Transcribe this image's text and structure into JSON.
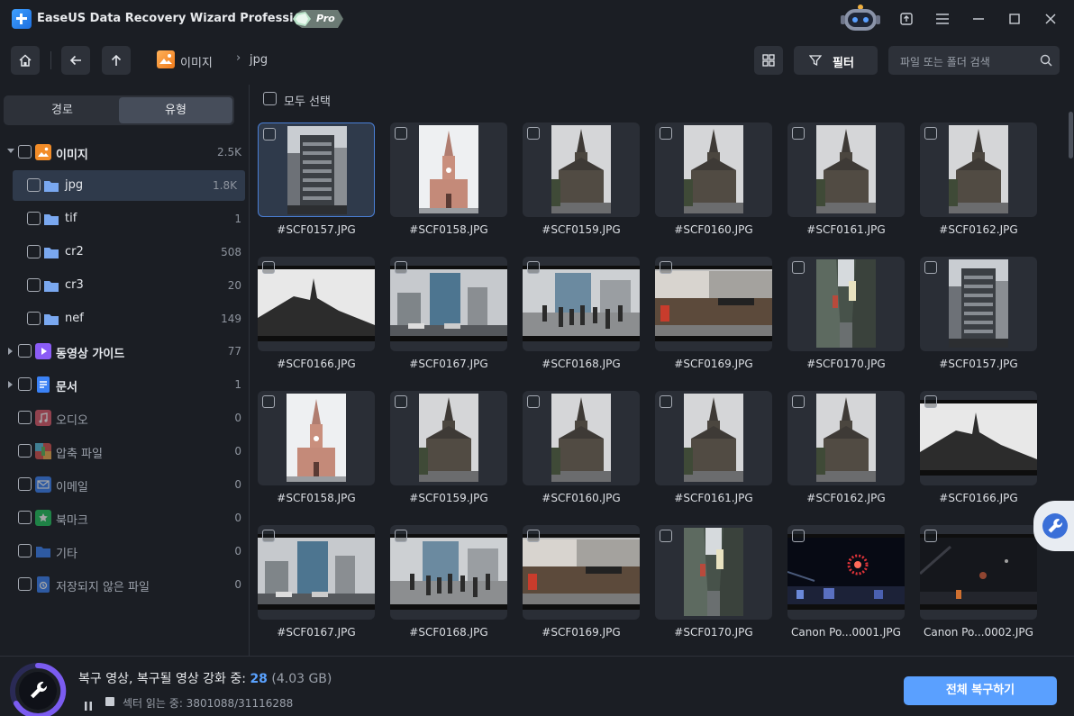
{
  "app": {
    "title": "EaseUS Data Recovery Wizard Professional",
    "badge": "Pro"
  },
  "nav": {
    "breadcrumb": [
      {
        "label": "이미지"
      },
      {
        "label": "jpg"
      }
    ],
    "filter_label": "필터",
    "search_placeholder": "파일 또는 폴더 검색"
  },
  "sidebar": {
    "tabs": [
      {
        "label": "경로",
        "active": false
      },
      {
        "label": "유형",
        "active": true
      }
    ],
    "items": [
      {
        "label": "이미지",
        "count": "2.5K",
        "icon": "image-folder-icon",
        "color": "#f28c28"
      },
      {
        "label": "jpg",
        "count": "1.8K",
        "icon": "folder-icon",
        "color": "#7aa8f0"
      },
      {
        "label": "tif",
        "count": "1",
        "icon": "folder-icon",
        "color": "#7aa8f0"
      },
      {
        "label": "cr2",
        "count": "508",
        "icon": "folder-icon",
        "color": "#7aa8f0"
      },
      {
        "label": "cr3",
        "count": "20",
        "icon": "folder-icon",
        "color": "#7aa8f0"
      },
      {
        "label": "nef",
        "count": "149",
        "icon": "folder-icon",
        "color": "#7aa8f0"
      },
      {
        "label": "동영상 가이드",
        "count": "77",
        "icon": "video-icon",
        "color": "#8b5cf6"
      },
      {
        "label": "문서",
        "count": "1",
        "icon": "document-icon",
        "color": "#3b82f6"
      },
      {
        "label": "오디오",
        "count": "0",
        "icon": "audio-icon",
        "color": "#e05a6a"
      },
      {
        "label": "압축 파일",
        "count": "0",
        "icon": "archive-icon",
        "color": "#4a90e2"
      },
      {
        "label": "이메일",
        "count": "0",
        "icon": "email-icon",
        "color": "#3b82f6"
      },
      {
        "label": "북마크",
        "count": "0",
        "icon": "bookmark-icon",
        "color": "#22c55e"
      },
      {
        "label": "기타",
        "count": "0",
        "icon": "other-folder-icon",
        "color": "#3b82f6"
      },
      {
        "label": "저장되지 않은 파일",
        "count": "0",
        "icon": "unsaved-file-icon",
        "color": "#3b82f6"
      }
    ]
  },
  "main": {
    "select_all_label": "모두 선택",
    "files": [
      {
        "name": "#SCF0157.JPG",
        "kind": "tall-building"
      },
      {
        "name": "#SCF0158.JPG",
        "kind": "brick-church"
      },
      {
        "name": "#SCF0159.JPG",
        "kind": "dark-church"
      },
      {
        "name": "#SCF0160.JPG",
        "kind": "dark-church"
      },
      {
        "name": "#SCF0161.JPG",
        "kind": "dark-church"
      },
      {
        "name": "#SCF0162.JPG",
        "kind": "dark-church"
      },
      {
        "name": "#SCF0166.JPG",
        "kind": "church-silhouette"
      },
      {
        "name": "#SCF0167.JPG",
        "kind": "city-street"
      },
      {
        "name": "#SCF0168.JPG",
        "kind": "crowd-street"
      },
      {
        "name": "#SCF0169.JPG",
        "kind": "shop-street"
      },
      {
        "name": "#SCF0170.JPG",
        "kind": "alley"
      },
      {
        "name": "#SCF0157.JPG",
        "kind": "tall-building"
      },
      {
        "name": "#SCF0158.JPG",
        "kind": "brick-church"
      },
      {
        "name": "#SCF0159.JPG",
        "kind": "dark-church"
      },
      {
        "name": "#SCF0160.JPG",
        "kind": "dark-church"
      },
      {
        "name": "#SCF0161.JPG",
        "kind": "dark-church"
      },
      {
        "name": "#SCF0162.JPG",
        "kind": "dark-church"
      },
      {
        "name": "#SCF0166.JPG",
        "kind": "church-silhouette"
      },
      {
        "name": "#SCF0167.JPG",
        "kind": "city-street"
      },
      {
        "name": "#SCF0168.JPG",
        "kind": "crowd-street"
      },
      {
        "name": "#SCF0169.JPG",
        "kind": "shop-street"
      },
      {
        "name": "#SCF0170.JPG",
        "kind": "alley"
      },
      {
        "name": "Canon Po...0001.JPG",
        "kind": "fireworks"
      },
      {
        "name": "Canon Po...0002.JPG",
        "kind": "fireworks-dim"
      }
    ]
  },
  "status": {
    "main_prefix": "복구 영상, 복구될 영상 강화 중:",
    "count": "28",
    "size": "(4.03 GB)",
    "sub": "섹터 읽는 중: 3801088/31116288"
  },
  "recover_all_label": "전체 복구하기",
  "colors": {
    "accent": "#5aa0ff",
    "background": "#1b1e24",
    "card": "#2a2e36"
  }
}
